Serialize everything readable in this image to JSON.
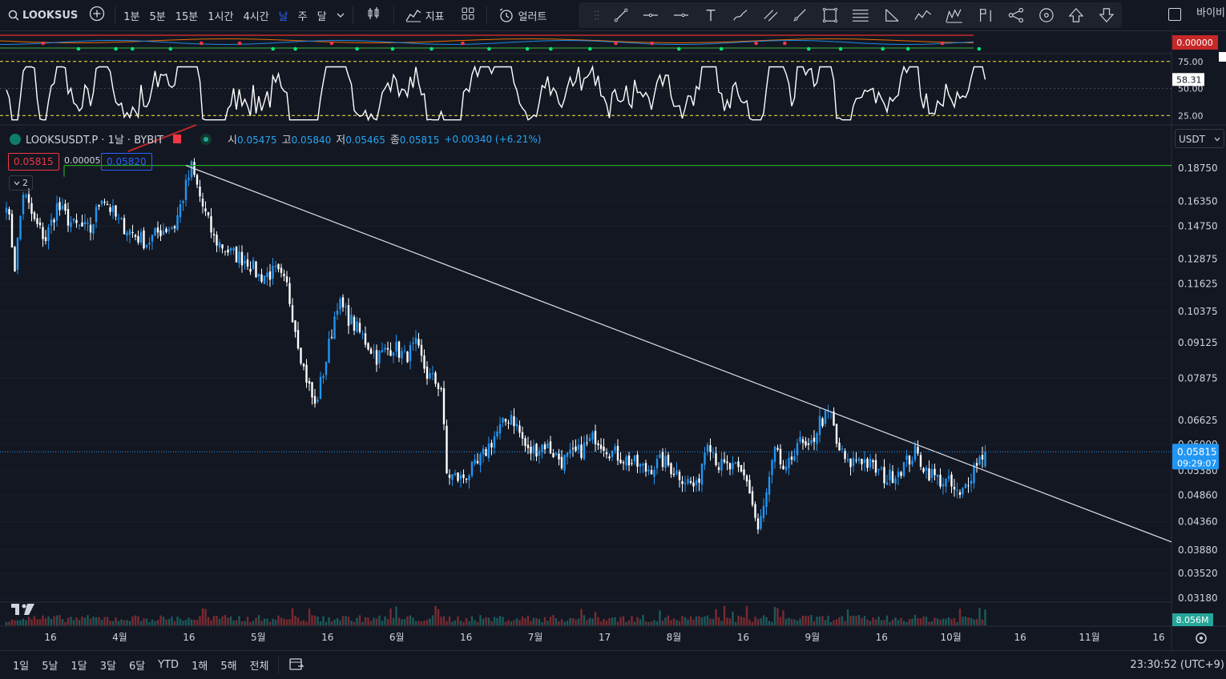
{
  "toolbar": {
    "symbol": "LOOKSUS",
    "intervals": [
      "1분",
      "5분",
      "15분",
      "1시간",
      "4시간",
      "날",
      "주",
      "달"
    ],
    "active_interval": "날",
    "indicators_label": "지표",
    "alerts_label": "얼러트",
    "right_label": "바이비"
  },
  "legend": {
    "symbol": "LOOKSUSDT.P · 1날 · BYBIT",
    "open_label": "시",
    "open": "0.05475",
    "high_label": "고",
    "high": "0.05840",
    "low_label": "저",
    "low": "0.05465",
    "close_label": "종",
    "close": "0.05815",
    "change": "+0.00340 (+6.21%)",
    "bid": "0.05815",
    "spread": "0.00005",
    "ask": "0.05820",
    "collapse": "2"
  },
  "currency": "USDT",
  "bottom": {
    "ranges": [
      "1일",
      "5날",
      "1달",
      "3달",
      "6달",
      "YTD",
      "1해",
      "5해",
      "전체"
    ],
    "clock": "23:30:52 (UTC+9)"
  },
  "chart_data": {
    "type": "candlestick",
    "price_axis": {
      "scale": "log",
      "ticks": [
        "0.18750",
        "0.16350",
        "0.14750",
        "0.12875",
        "0.11625",
        "0.10375",
        "0.09125",
        "0.07875",
        "0.06625",
        "0.06000",
        "0.05380",
        "0.04860",
        "0.04360",
        "0.03880",
        "0.03520",
        "0.03180"
      ],
      "ylim": [
        0.0318,
        0.195
      ]
    },
    "time_axis": {
      "labels": [
        "16",
        "4월",
        "16",
        "5월",
        "16",
        "6월",
        "16",
        "7월",
        "17",
        "8월",
        "16",
        "9월",
        "16",
        "10월",
        "16",
        "11월",
        "16"
      ]
    },
    "current_price": "0.05815",
    "countdown": "09:29:07",
    "volume_last": "8.056M",
    "oscillator": {
      "ticks": [
        "75.00",
        "50.00",
        "25.00"
      ],
      "ylim": [
        20,
        80
      ],
      "levels": [
        75,
        25
      ],
      "value": "58.31"
    },
    "top_indicator_value": "0.00000",
    "resistance_level": 0.1895,
    "trendline": {
      "from_price": 0.1895,
      "to_price": 0.0401
    },
    "anchors": [
      [
        0,
        0.165
      ],
      [
        3,
        0.125
      ],
      [
        6,
        0.17
      ],
      [
        10,
        0.15
      ],
      [
        14,
        0.14
      ],
      [
        18,
        0.16
      ],
      [
        24,
        0.148
      ],
      [
        30,
        0.145
      ],
      [
        34,
        0.168
      ],
      [
        40,
        0.15
      ],
      [
        46,
        0.142
      ],
      [
        50,
        0.138
      ],
      [
        55,
        0.145
      ],
      [
        60,
        0.148
      ],
      [
        66,
        0.188
      ],
      [
        70,
        0.16
      ],
      [
        74,
        0.14
      ],
      [
        80,
        0.132
      ],
      [
        86,
        0.128
      ],
      [
        90,
        0.12
      ],
      [
        96,
        0.122
      ],
      [
        100,
        0.115
      ],
      [
        106,
        0.082
      ],
      [
        110,
        0.07
      ],
      [
        114,
        0.085
      ],
      [
        118,
        0.108
      ],
      [
        124,
        0.098
      ],
      [
        128,
        0.092
      ],
      [
        132,
        0.086
      ],
      [
        138,
        0.09
      ],
      [
        142,
        0.086
      ],
      [
        146,
        0.09
      ],
      [
        150,
        0.08
      ],
      [
        155,
        0.076
      ],
      [
        157,
        0.053
      ],
      [
        162,
        0.052
      ],
      [
        168,
        0.055
      ],
      [
        174,
        0.062
      ],
      [
        180,
        0.068
      ],
      [
        186,
        0.058
      ],
      [
        192,
        0.06
      ],
      [
        198,
        0.056
      ],
      [
        204,
        0.058
      ],
      [
        210,
        0.062
      ],
      [
        216,
        0.058
      ],
      [
        222,
        0.056
      ],
      [
        228,
        0.054
      ],
      [
        234,
        0.056
      ],
      [
        240,
        0.053
      ],
      [
        246,
        0.05
      ],
      [
        250,
        0.062
      ],
      [
        254,
        0.055
      ],
      [
        260,
        0.054
      ],
      [
        264,
        0.052
      ],
      [
        268,
        0.042
      ],
      [
        270,
        0.046
      ],
      [
        274,
        0.058
      ],
      [
        278,
        0.053
      ],
      [
        282,
        0.061
      ],
      [
        286,
        0.058
      ],
      [
        290,
        0.066
      ],
      [
        294,
        0.068
      ],
      [
        296,
        0.06
      ],
      [
        300,
        0.055
      ],
      [
        304,
        0.057
      ],
      [
        310,
        0.054
      ],
      [
        314,
        0.052
      ],
      [
        320,
        0.055
      ],
      [
        324,
        0.058
      ],
      [
        328,
        0.054
      ],
      [
        332,
        0.052
      ],
      [
        336,
        0.051
      ],
      [
        340,
        0.048
      ],
      [
        343,
        0.052
      ],
      [
        346,
        0.056
      ],
      [
        349,
        0.058
      ]
    ]
  }
}
